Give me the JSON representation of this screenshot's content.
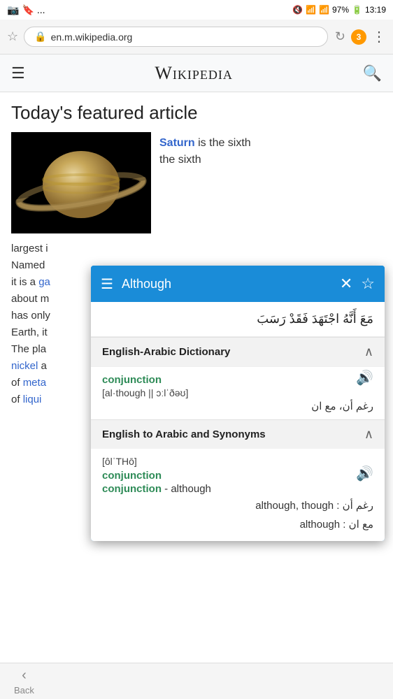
{
  "status_bar": {
    "left_icons": [
      "📷",
      "🔖",
      "..."
    ],
    "mute_icon": "🔇",
    "wifi_icon": "WiFi",
    "signal_icon": "📶",
    "battery": "97%",
    "time": "13:19"
  },
  "browser": {
    "url": "en.m.wikipedia.org",
    "tab_count": "3"
  },
  "wiki": {
    "title": "Wikipedia",
    "featured_heading": "Today's featured article"
  },
  "article": {
    "saturn_link": "Saturn",
    "snippet_right": " is the sixth",
    "below_text": "largest in",
    "below_lines": [
      "largest in",
      "Named",
      "it is a ga",
      "about m",
      "has only",
      "Earth, it",
      "The pla",
      "nickel a",
      "of meta",
      "of liqui"
    ]
  },
  "dictionary": {
    "search_word": "Although",
    "arabic_text": "مَعَ أَنَّهُ اجْتَهَدَ فَقَدْ رَسَبَ",
    "section1": {
      "title": "English-Arabic Dictionary",
      "word_type": "conjunction",
      "pronunciation": "[al·though || ɔːlˈðəʊ]",
      "translation": "رغم أن، مع ان"
    },
    "section2": {
      "title": "English to Arabic and Synonyms",
      "phonetic": "[ôlˈTHō]",
      "word_type": "conjunction",
      "definition": "- although",
      "translations": [
        "رغم أن : although, though",
        "مع ان : although"
      ]
    }
  },
  "bottom_nav": {
    "back_label": "Back"
  }
}
